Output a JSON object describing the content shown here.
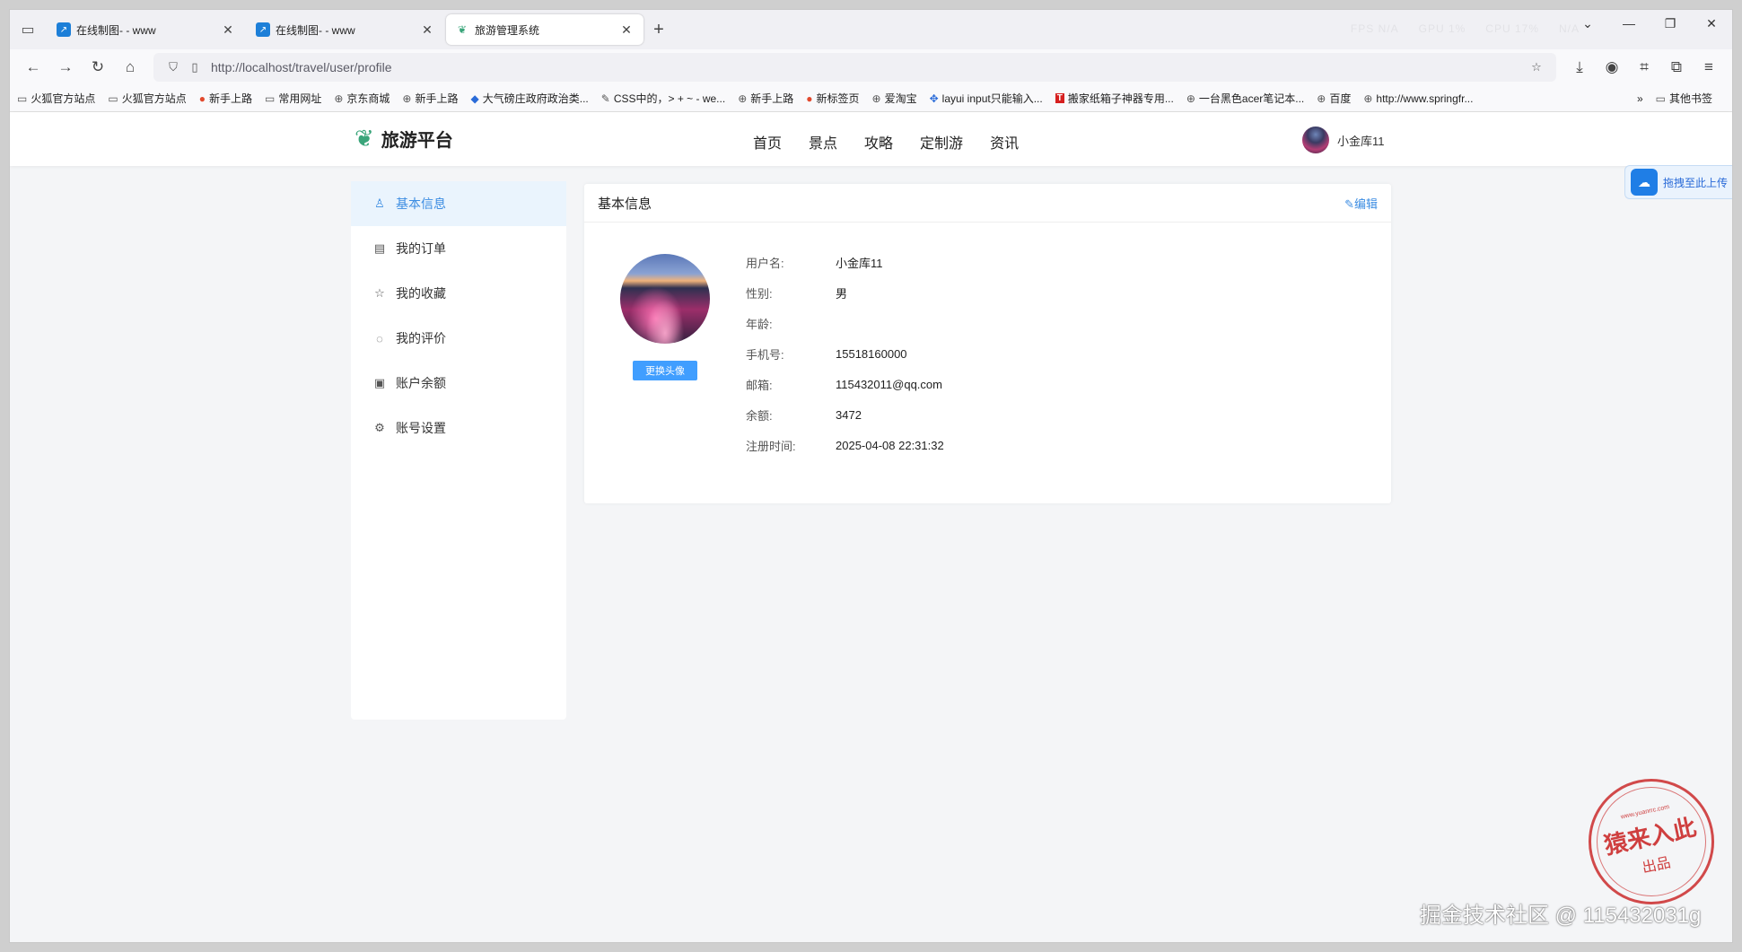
{
  "browser": {
    "tabs": [
      {
        "title": "在线制图- - www",
        "icon": "chart-icon",
        "active": false
      },
      {
        "title": "在线制图- - www",
        "icon": "chart-icon",
        "active": false
      },
      {
        "title": "旅游管理系统",
        "icon": "leaf-icon",
        "active": true
      }
    ],
    "perf": [
      "FPS N/A",
      "GPU 1%",
      "CPU 17%",
      "N/A"
    ],
    "url": "http://localhost/travel/user/profile",
    "bookmarks": [
      {
        "label": "火狐官方站点",
        "icon": "folder-icon"
      },
      {
        "label": "火狐官方站点",
        "icon": "folder-icon"
      },
      {
        "label": "新手上路",
        "icon": "firefox-icon"
      },
      {
        "label": "常用网址",
        "icon": "folder-icon"
      },
      {
        "label": "京东商城",
        "icon": "globe-icon"
      },
      {
        "label": "新手上路",
        "icon": "globe-icon"
      },
      {
        "label": "大气磅庄政府政治类...",
        "icon": "site-icon"
      },
      {
        "label": "CSS中的，> + ~ - we...",
        "icon": "site-icon"
      },
      {
        "label": "新手上路",
        "icon": "globe-icon"
      },
      {
        "label": "新标签页",
        "icon": "firefox-icon"
      },
      {
        "label": "爱淘宝",
        "icon": "globe-icon"
      },
      {
        "label": "layui input只能输入...",
        "icon": "paw-icon"
      },
      {
        "label": "搬家纸箱子神器专用...",
        "icon": "t-icon"
      },
      {
        "label": "一台黑色acer笔记本...",
        "icon": "globe-icon"
      },
      {
        "label": "百度",
        "icon": "globe-icon"
      },
      {
        "label": "http://www.springfr...",
        "icon": "globe-icon"
      }
    ],
    "other_bookmarks": "其他书签"
  },
  "site": {
    "logo": "旅游平台",
    "nav": [
      "首页",
      "景点",
      "攻略",
      "定制游",
      "资讯"
    ],
    "username": "小金库11",
    "float_upload": "拖拽至此上传"
  },
  "sidebar": {
    "items": [
      {
        "label": "基本信息",
        "icon": "user-icon",
        "active": true
      },
      {
        "label": "我的订单",
        "icon": "document-icon",
        "active": false
      },
      {
        "label": "我的收藏",
        "icon": "star-icon",
        "active": false
      },
      {
        "label": "我的评价",
        "icon": "comment-icon",
        "active": false
      },
      {
        "label": "账户余额",
        "icon": "wallet-icon",
        "active": false
      },
      {
        "label": "账号设置",
        "icon": "gear-icon",
        "active": false
      }
    ]
  },
  "profile": {
    "title": "基本信息",
    "edit": "编辑",
    "change_avatar": "更换头像",
    "fields": [
      {
        "label": "用户名:",
        "value": "小金库11"
      },
      {
        "label": "性别:",
        "value": "男"
      },
      {
        "label": "年龄:",
        "value": ""
      },
      {
        "label": "手机号:",
        "value": "15518160000"
      },
      {
        "label": "邮箱:",
        "value": "115432011@qq.com"
      },
      {
        "label": "余额:",
        "value": "3472"
      },
      {
        "label": "注册时间:",
        "value": "2025-04-08 22:31:32"
      }
    ]
  },
  "overlay": {
    "seal_url": "www.yuanrrc.com",
    "seal_main": "猿来入此",
    "seal_sub": "出品",
    "watermark": "掘金技术社区 @ 115432031g"
  },
  "colors": {
    "accent": "#3b8ce2",
    "button": "#409eff",
    "brand_leaf": "#3aa57a"
  }
}
